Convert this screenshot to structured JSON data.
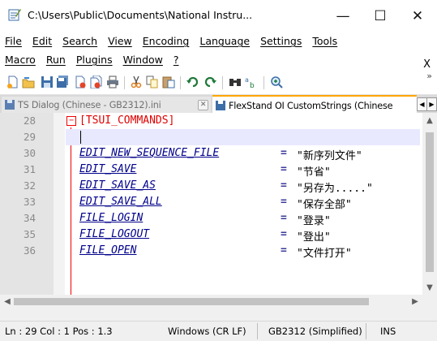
{
  "window": {
    "title": "C:\\Users\\Public\\Documents\\National Instru...",
    "minimize": "—",
    "maximize": "☐",
    "close": "✕"
  },
  "menu": {
    "row1": [
      "File",
      "Edit",
      "Search",
      "View",
      "Encoding",
      "Language",
      "Settings",
      "Tools"
    ],
    "row2": [
      "Macro",
      "Run",
      "Plugins",
      "Window",
      "?"
    ],
    "doc_close": "X"
  },
  "toolbar": {
    "icons": [
      "new-file-icon",
      "open-file-icon",
      "save-icon",
      "save-all-icon",
      "close-icon",
      "close-all-icon",
      "print-icon",
      "cut-icon",
      "copy-icon",
      "paste-icon",
      "undo-icon",
      "redo-icon",
      "find-icon",
      "replace-icon",
      "zoom-in-icon"
    ],
    "more": "»"
  },
  "tabs": [
    {
      "label": "TS Dialog (Chinese - GB2312).ini",
      "active": false
    },
    {
      "label": "FlexStand OI CustomStrings (Chinese",
      "active": true
    }
  ],
  "editor": {
    "lines": [
      {
        "num": "28",
        "type": "section",
        "key": "[TSUI_COMMANDS]",
        "value": ""
      },
      {
        "num": "29",
        "type": "blank",
        "key": "",
        "value": ""
      },
      {
        "num": "30",
        "type": "entry",
        "key": "EDIT_NEW_SEQUENCE_FILE",
        "value": "\"新序列文件\""
      },
      {
        "num": "31",
        "type": "entry",
        "key": "EDIT_SAVE",
        "value": "\"节省\""
      },
      {
        "num": "32",
        "type": "entry",
        "key": "EDIT_SAVE_AS",
        "value": "\"另存为.....\""
      },
      {
        "num": "33",
        "type": "entry",
        "key": "EDIT_SAVE_ALL",
        "value": "\"保存全部\""
      },
      {
        "num": "34",
        "type": "entry",
        "key": "FILE_LOGIN",
        "value": "\"登录\""
      },
      {
        "num": "35",
        "type": "entry",
        "key": "FILE_LOGOUT",
        "value": "\"登出\""
      },
      {
        "num": "36",
        "type": "entry",
        "key": "FILE_OPEN",
        "value": "\"文件打开\""
      }
    ],
    "equals": "="
  },
  "status": {
    "position": "Ln : 29   Col : 1   Pos : 1.3",
    "eol": "Windows (CR LF)",
    "encoding": "GB2312 (Simplified)",
    "mode": "INS"
  }
}
